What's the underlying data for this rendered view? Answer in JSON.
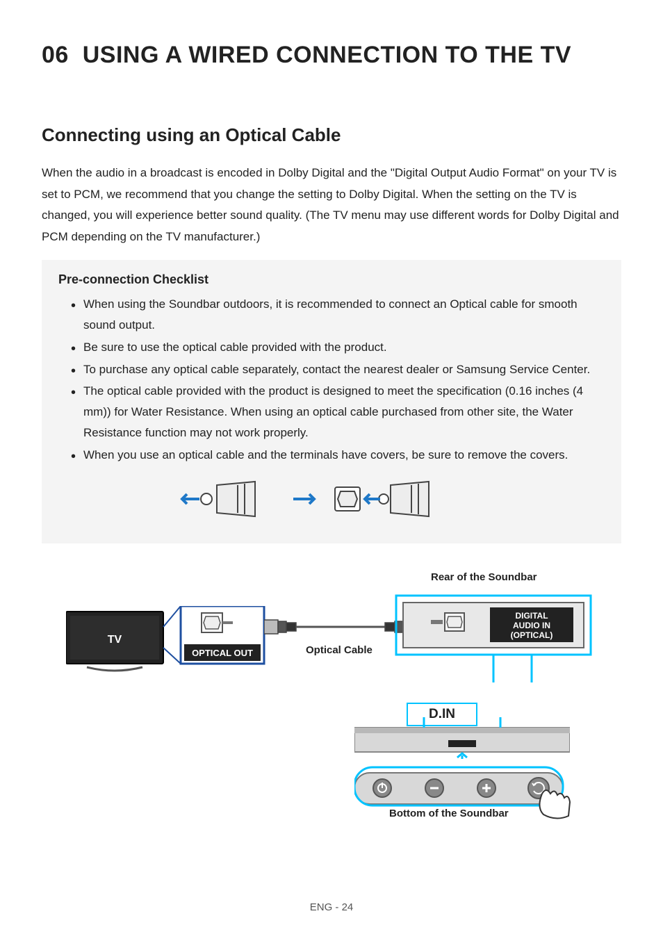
{
  "chapter": {
    "number": "06",
    "title": "USING A WIRED CONNECTION TO THE TV"
  },
  "section": {
    "title": "Connecting using an Optical Cable",
    "intro": "When the audio in a broadcast is encoded in Dolby Digital and the \"Digital Output Audio Format\" on your TV is set to PCM, we recommend that you change the setting to Dolby Digital. When the setting on the TV is changed, you will experience better sound quality. (The TV menu may use different words for Dolby Digital and PCM depending on the TV manufacturer.)"
  },
  "checklist": {
    "title": "Pre-connection Checklist",
    "items": [
      "When using the Soundbar outdoors, it is recommended to connect an Optical cable for smooth sound output.",
      "Be sure to use the optical cable provided with the product.",
      "To purchase any optical cable separately, contact the nearest dealer or Samsung Service Center.",
      "The optical cable provided with the product is designed to meet the specification (0.16 inches (4 mm)) for Water Resistance. When using an optical cable purchased from other site, the Water Resistance function may not work properly.",
      "When you use an optical cable and the terminals have covers, be sure to remove the covers."
    ]
  },
  "diagram": {
    "rear_label": "Rear of the Soundbar",
    "bottom_label": "Bottom of the Soundbar",
    "tv_label": "TV",
    "optical_out": "OPTICAL OUT",
    "optical_cable": "Optical Cable",
    "digital_audio_in_1": "DIGITAL",
    "digital_audio_in_2": "AUDIO IN",
    "digital_audio_in_3": "(OPTICAL)",
    "din": "D.IN"
  },
  "footer": {
    "page": "ENG - 24"
  }
}
